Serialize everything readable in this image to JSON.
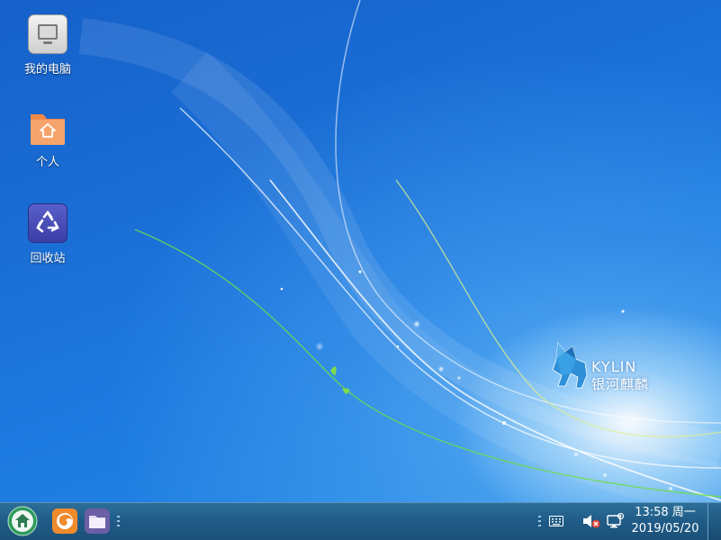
{
  "desktop": {
    "icons": [
      {
        "label": "我的电脑",
        "icon": "computer-icon"
      },
      {
        "label": "个人",
        "icon": "home-folder-icon"
      },
      {
        "label": "回收站",
        "icon": "trash-icon"
      }
    ],
    "wallpaper": {
      "brand": "KYLIN",
      "brand_sub": "银河麒麟",
      "colors": {
        "base": "#1a6fd6",
        "glow": "#dff2ff",
        "swoosh_green": "#7fdc4a"
      }
    }
  },
  "taskbar": {
    "start_icon": "home-start-icon",
    "launchers": [
      {
        "name": "browser",
        "icon": "firefox-icon"
      },
      {
        "name": "file-manager",
        "icon": "folder-icon"
      }
    ],
    "tray": {
      "keyboard_icon": "keyboard-icon",
      "volume_icon": "volume-muted-icon",
      "network_icon": "network-disconnected-icon"
    },
    "clock": {
      "time": "13:58 周一",
      "date": "2019/05/20"
    },
    "colors": {
      "bar": "#1f5b86",
      "accent": "#3aa56a"
    }
  }
}
